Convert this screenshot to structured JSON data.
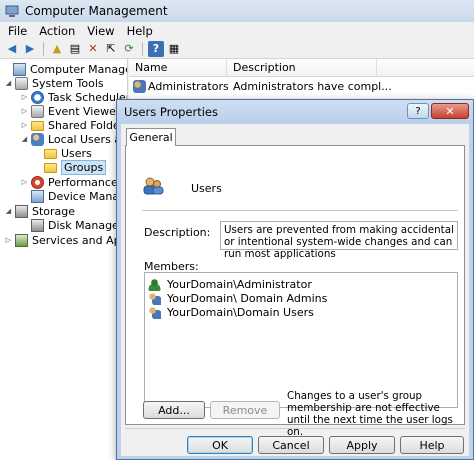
{
  "window": {
    "title": "Computer Management"
  },
  "menubar": [
    "File",
    "Action",
    "View",
    "Help"
  ],
  "toolbar": {
    "back": "◀",
    "forward": "▶",
    "up": "▲",
    "properties": "▤",
    "delete": "✕",
    "export": "⇱",
    "refresh": "⟳",
    "help": "?",
    "view": "▦"
  },
  "tree": [
    {
      "label": "Computer Management",
      "level": 0,
      "toggle": "",
      "icon": "computer-icon"
    },
    {
      "label": "System Tools",
      "level": 1,
      "toggle": "◢",
      "icon": "tools-icon"
    },
    {
      "label": "Task Scheduler",
      "level": 2,
      "toggle": "▷",
      "icon": "clock-icon"
    },
    {
      "label": "Event Viewer",
      "level": 2,
      "toggle": "▷",
      "icon": "event-icon"
    },
    {
      "label": "Shared Folders",
      "level": 2,
      "toggle": "▷",
      "icon": "folder-icon"
    },
    {
      "label": "Local Users and",
      "level": 2,
      "toggle": "◢",
      "icon": "users-icon"
    },
    {
      "label": "Users",
      "level": 3,
      "toggle": "",
      "icon": "folder-icon"
    },
    {
      "label": "Groups",
      "level": 3,
      "toggle": "",
      "icon": "folder-icon",
      "selected": true
    },
    {
      "label": "Performance",
      "level": 2,
      "toggle": "▷",
      "icon": "performance-icon"
    },
    {
      "label": "Device Managem",
      "level": 2,
      "toggle": "",
      "icon": "device-icon"
    },
    {
      "label": "Storage",
      "level": 1,
      "toggle": "◢",
      "icon": "storage-icon"
    },
    {
      "label": "Disk Managemen",
      "level": 2,
      "toggle": "",
      "icon": "disk-icon"
    },
    {
      "label": "Services and Applic",
      "level": 1,
      "toggle": "▷",
      "icon": "services-icon"
    }
  ],
  "list": {
    "columns": [
      "Name",
      "Description"
    ],
    "rows": [
      {
        "name": "Administrators",
        "description": "Administrators have compl..."
      }
    ]
  },
  "dialog": {
    "title": "Users Properties",
    "help": "?",
    "close": "✕",
    "tab": "General",
    "group_name": "Users",
    "description_label": "Description:",
    "description": "Users are prevented from making accidental or intentional system-wide changes and can run most applications",
    "members_label": "Members:",
    "members": [
      "YourDomain\\Administrator",
      "YourDomain\\ Domain  Admins",
      "YourDomain\\Domain Users"
    ],
    "add_button": "Add...",
    "remove_button": "Remove",
    "note": "Changes to a user's group membership are not effective until the next time the user logs on.",
    "ok": "OK",
    "cancel": "Cancel",
    "apply": "Apply",
    "help_button": "Help"
  }
}
